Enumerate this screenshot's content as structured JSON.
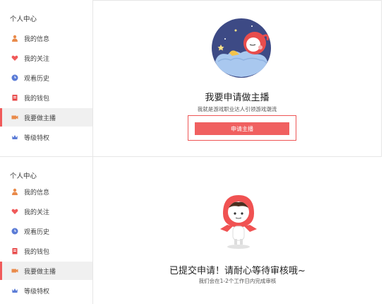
{
  "sidebar": {
    "title": "个人中心",
    "items": [
      {
        "label": "我的信息",
        "icon": "user-icon"
      },
      {
        "label": "我的关注",
        "icon": "heart-icon"
      },
      {
        "label": "观看历史",
        "icon": "clock-icon"
      },
      {
        "label": "我的钱包",
        "icon": "wallet-icon"
      },
      {
        "label": "我要做主播",
        "icon": "camera-icon",
        "active": true
      },
      {
        "label": "等级特权",
        "icon": "crown-icon"
      }
    ]
  },
  "apply": {
    "title": "我要申请做主播",
    "subtitle": "我就是游戏职业达人引领游戏潮流",
    "button": "申请主播"
  },
  "submitted": {
    "title": "已提交申请！请耐心等待审核哦~",
    "subtitle": "我们会在1-2个工作日内完成审核"
  },
  "colors": {
    "accent": "#f06060",
    "active_bg": "#f0f0f0",
    "icon_orange": "#e98a4a",
    "icon_blue": "#5a7bd6"
  }
}
